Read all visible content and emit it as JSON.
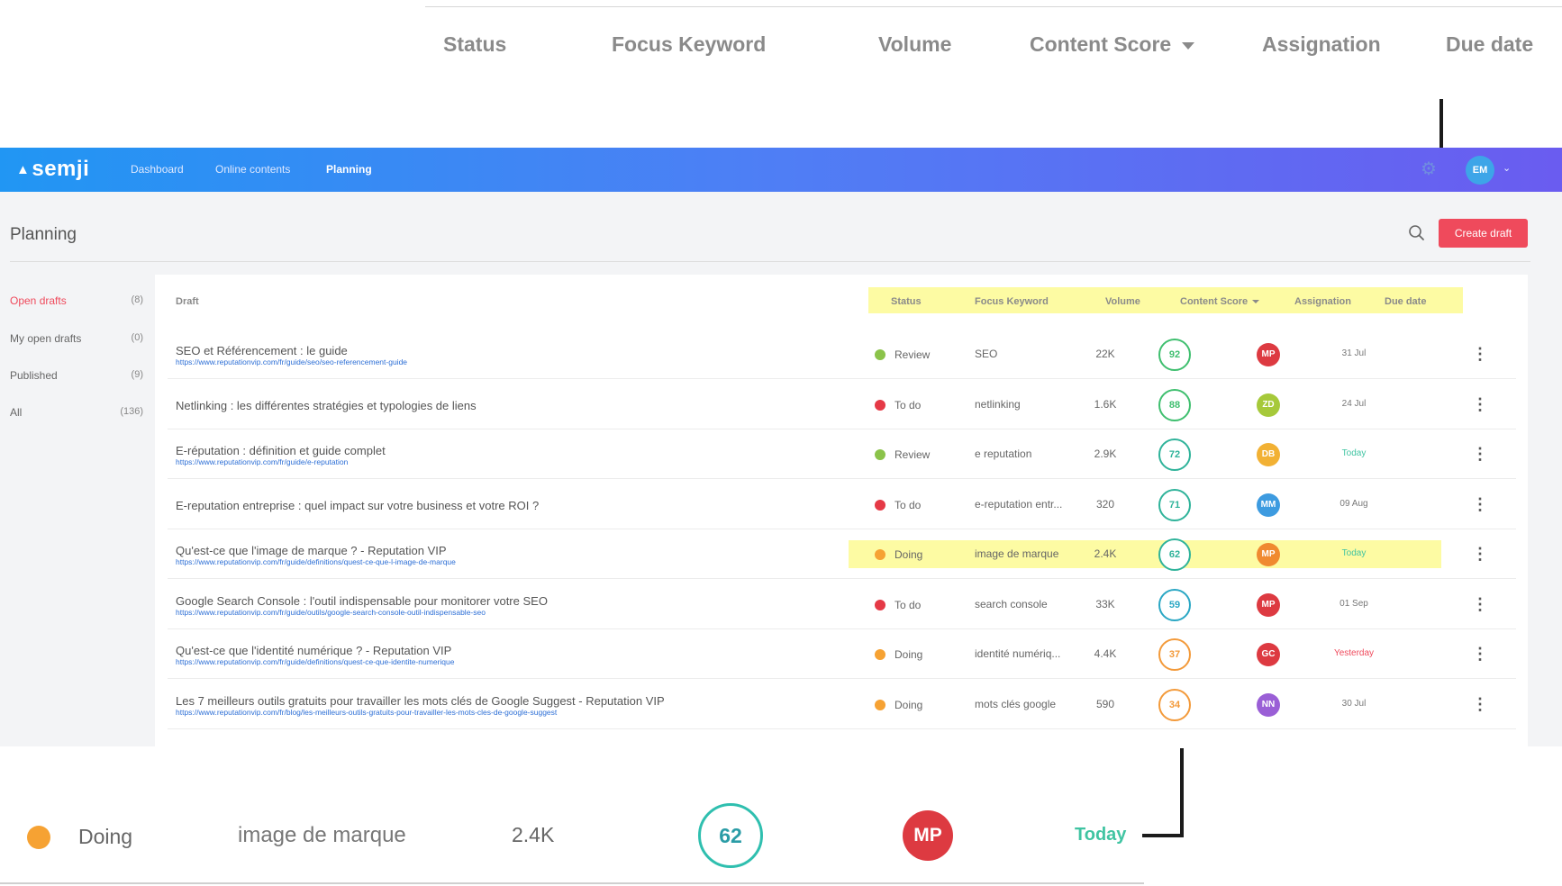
{
  "zoom_header": {
    "status": "Status",
    "focus_keyword": "Focus Keyword",
    "volume": "Volume",
    "content_score": "Content Score",
    "assignation": "Assignation",
    "due_date": "Due date"
  },
  "app": {
    "logo": "semji",
    "nav": [
      "Dashboard",
      "Online contents",
      "Planning"
    ],
    "active_nav": "Planning",
    "user_initials": "EM",
    "page_title": "Planning",
    "create_button": "Create draft"
  },
  "sidebar": [
    {
      "label": "Open drafts",
      "count": "(8)",
      "active": true
    },
    {
      "label": "My open drafts",
      "count": "(0)",
      "active": false
    },
    {
      "label": "Published",
      "count": "(9)",
      "active": false
    },
    {
      "label": "All",
      "count": "(136)",
      "active": false
    }
  ],
  "table": {
    "headers": {
      "draft": "Draft",
      "status": "Status",
      "focus_keyword": "Focus Keyword",
      "volume": "Volume",
      "content_score": "Content Score",
      "assignation": "Assignation",
      "due_date": "Due date"
    },
    "rows": [
      {
        "title": "SEO et Référencement : le guide",
        "url": "https://www.reputationvip.com/fr/guide/seo/seo-referencement-guide",
        "status": "Review",
        "status_color": "#8bc34a",
        "keyword": "SEO",
        "volume": "22K",
        "score": "92",
        "score_color": "#3fbf6f",
        "assignee": "MP",
        "assignee_color": "#dd3a41",
        "due": "31 Jul",
        "due_color": "#777777"
      },
      {
        "title": "Netlinking : les différentes stratégies et typologies de liens",
        "url": "",
        "status": "To do",
        "status_color": "#e53946",
        "keyword": "netlinking",
        "volume": "1.6K",
        "score": "88",
        "score_color": "#3fbf6f",
        "assignee": "ZD",
        "assignee_color": "#a6c93a",
        "due": "24 Jul",
        "due_color": "#777777"
      },
      {
        "title": "E-réputation : définition et guide complet",
        "url": "https://www.reputationvip.com/fr/guide/e-reputation",
        "status": "Review",
        "status_color": "#8bc34a",
        "keyword": "e reputation",
        "volume": "2.9K",
        "score": "72",
        "score_color": "#2fb39a",
        "assignee": "DB",
        "assignee_color": "#f2b134",
        "due": "Today",
        "due_color": "#40c4a2"
      },
      {
        "title": "E-reputation entreprise : quel impact sur votre business et votre ROI ?",
        "url": "",
        "status": "To do",
        "status_color": "#e53946",
        "keyword": "e-reputation entr...",
        "volume": "320",
        "score": "71",
        "score_color": "#2fb39a",
        "assignee": "MM",
        "assignee_color": "#3d9be0",
        "due": "09 Aug",
        "due_color": "#777777"
      },
      {
        "title": "Qu'est-ce que l'image de marque ? - Reputation VIP",
        "url": "https://www.reputationvip.com/fr/guide/definitions/quest-ce-que-l-image-de-marque",
        "status": "Doing",
        "status_color": "#f6a233",
        "keyword": "image de marque",
        "volume": "2.4K",
        "score": "62",
        "score_color": "#2fb39a",
        "assignee": "MP",
        "assignee_color": "#f08a30",
        "due": "Today",
        "due_color": "#40c4a2",
        "highlight": true
      },
      {
        "title": "Google Search Console : l'outil indispensable pour monitorer votre SEO",
        "url": "https://www.reputationvip.com/fr/guide/outils/google-search-console-outil-indispensable-seo",
        "status": "To do",
        "status_color": "#e53946",
        "keyword": "search console",
        "volume": "33K",
        "score": "59",
        "score_color": "#2aa7c4",
        "assignee": "MP",
        "assignee_color": "#dd3a41",
        "due": "01 Sep",
        "due_color": "#777777"
      },
      {
        "title": "Qu'est-ce que l'identité numérique ? - Reputation VIP",
        "url": "https://www.reputationvip.com/fr/guide/definitions/quest-ce-que-identite-numerique",
        "status": "Doing",
        "status_color": "#f6a233",
        "keyword": "identité numériq...",
        "volume": "4.4K",
        "score": "37",
        "score_color": "#f39a3a",
        "assignee": "GC",
        "assignee_color": "#dd3a41",
        "due": "Yesterday",
        "due_color": "#ef4a5c"
      },
      {
        "title": "Les 7 meilleurs outils gratuits pour travailler les mots clés de Google Suggest - Reputation VIP",
        "url": "https://www.reputationvip.com/fr/blog/les-meilleurs-outils-gratuits-pour-travailler-les-mots-cles-de-google-suggest",
        "status": "Doing",
        "status_color": "#f6a233",
        "keyword": "mots clés google",
        "volume": "590",
        "score": "34",
        "score_color": "#f39a3a",
        "assignee": "NN",
        "assignee_color": "#9a5fd6",
        "due": "30 Jul",
        "due_color": "#777777"
      }
    ]
  },
  "zoom_row": {
    "status": "Doing",
    "keyword": "image de marque",
    "volume": "2.4K",
    "score": "62",
    "assignee": "MP",
    "due": "Today"
  },
  "colors": {
    "accent": "#ef4a5c",
    "highlight": "#fdfba3",
    "gradient_start": "#2196f3",
    "gradient_end": "#6a5cf0"
  }
}
